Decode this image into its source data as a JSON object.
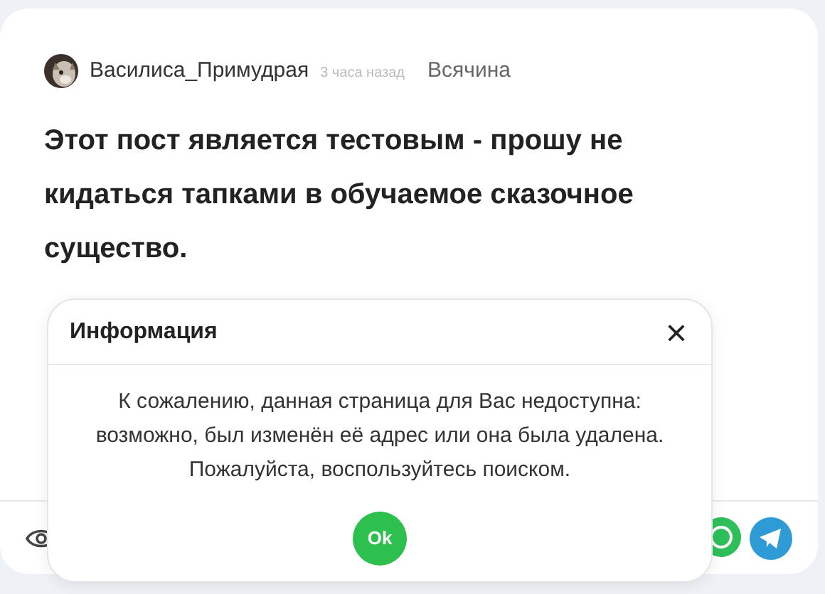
{
  "post": {
    "author": "Василиса_Примудрая",
    "time": "3 часа назад",
    "category": "Всячина",
    "title": "Этот пост является тестовым - прошу не кидаться тапками в обучаемое сказочное существо."
  },
  "dialog": {
    "title": "Информация",
    "close": "×",
    "message": "К сожалению, данная страница для Вас недоступна: возможно, был изменён её адрес или она была удалена. Пожалуйста, воспользуйтесь поиском.",
    "button": "Ok"
  }
}
